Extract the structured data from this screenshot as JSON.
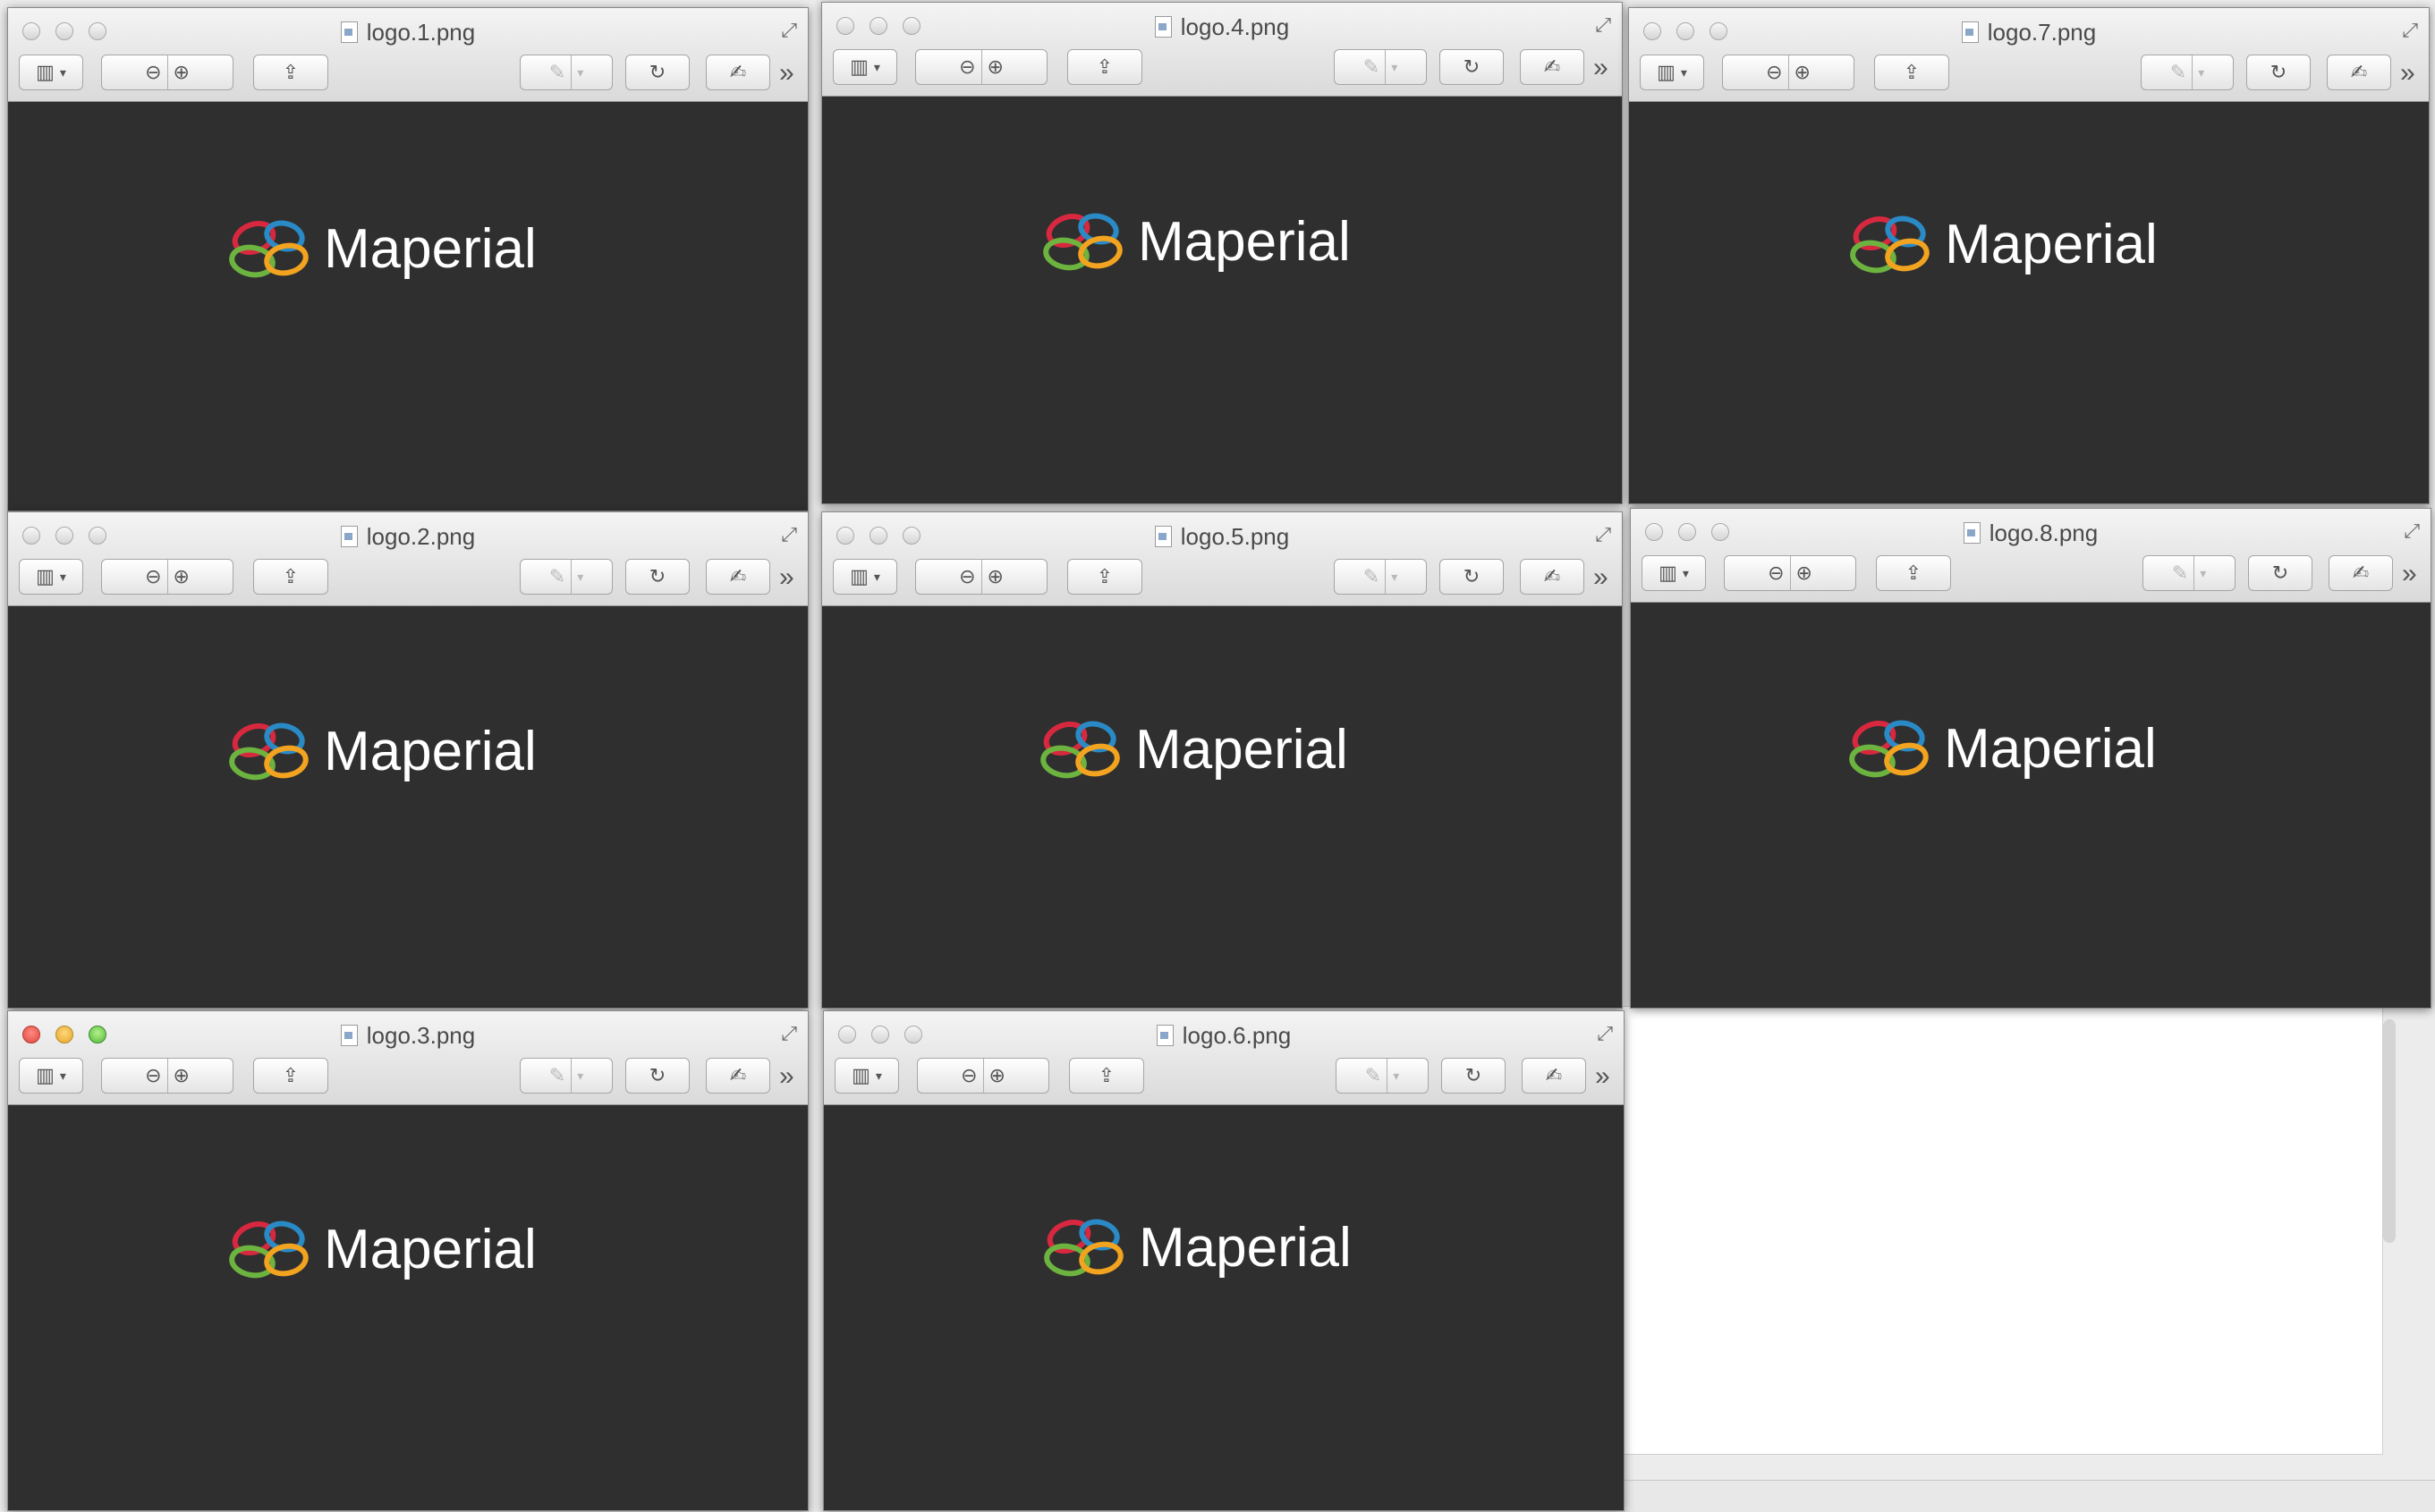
{
  "windows": [
    {
      "id": "w1",
      "title": "logo.1.png",
      "wordmark": "Maperial",
      "active": false
    },
    {
      "id": "w4",
      "title": "logo.4.png",
      "wordmark": "Maperial",
      "active": false
    },
    {
      "id": "w7",
      "title": "logo.7.png",
      "wordmark": "Maperial",
      "active": false
    },
    {
      "id": "w2",
      "title": "logo.2.png",
      "wordmark": "Maperial",
      "active": false
    },
    {
      "id": "w5",
      "title": "logo.5.png",
      "wordmark": "Maperial",
      "active": false
    },
    {
      "id": "w8",
      "title": "logo.8.png",
      "wordmark": "Maperial",
      "active": false
    },
    {
      "id": "w3",
      "title": "logo.3.png",
      "wordmark": "Maperial",
      "active": true
    },
    {
      "id": "w6",
      "title": "logo.6.png",
      "wordmark": "Maperial",
      "active": false
    }
  ],
  "toolbar": {
    "sidebar_icon": "sidebar-icon",
    "zoom_out_icon": "zoom-out-icon",
    "zoom_in_icon": "zoom-in-icon",
    "share_icon": "share-icon",
    "markup_icon": "pen-icon",
    "rotate_icon": "rotate-icon",
    "edit_icon": "edit-icon",
    "overflow_icon": "chevron-double-right-icon"
  },
  "logo_colors": {
    "red": "#d8283f",
    "blue": "#2a8ac6",
    "green": "#6cb43f",
    "orange": "#f2a31f"
  },
  "colors": {
    "canvas": "#2f2f2f",
    "wordmark": "#ffffff"
  }
}
